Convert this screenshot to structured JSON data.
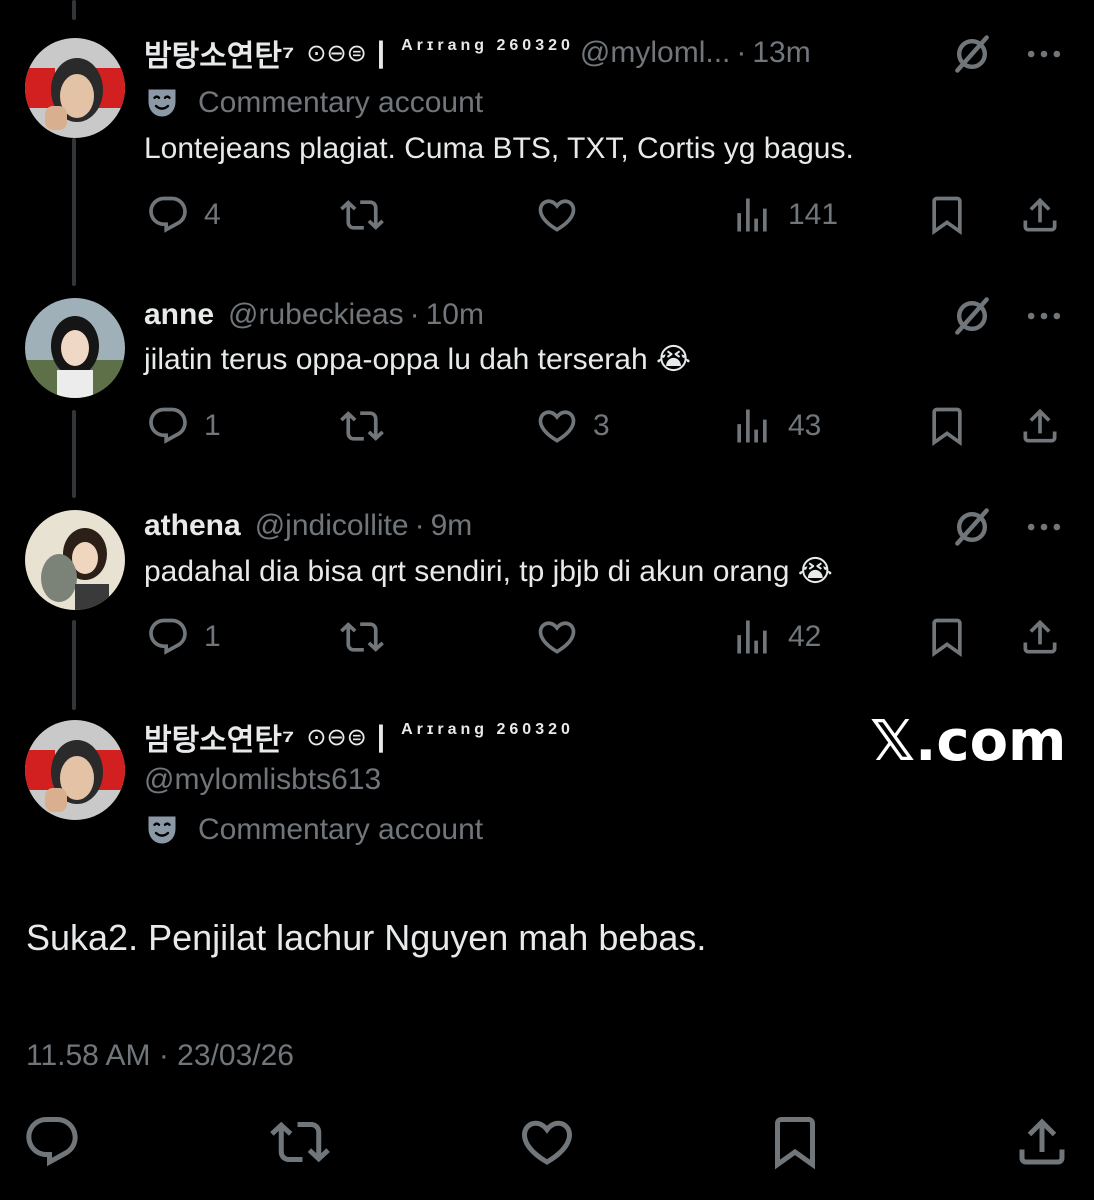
{
  "replies": [
    {
      "display_name": "밤탕소연탄⁷",
      "flair_circles": "⊙⊖⊜",
      "flair_bar": "|",
      "flair_text": "Arɪrang 260320",
      "handle": "@myloml...",
      "separator": "·",
      "time": "13m",
      "label": "Commentary account",
      "text": "Lontejeans plagiat. Cuma BTS, TXT, Cortis yg bagus.",
      "reply_count": "4",
      "retweet_count": "",
      "like_count": "",
      "view_count": "141"
    },
    {
      "display_name": "anne",
      "handle": "@rubeckieas",
      "separator": "·",
      "time": "10m",
      "text": "jilatin terus oppa-oppa lu dah terserah 😭",
      "reply_count": "1",
      "retweet_count": "",
      "like_count": "3",
      "view_count": "43"
    },
    {
      "display_name": "athena",
      "handle": "@jndicollite",
      "separator": "·",
      "time": "9m",
      "text": "padahal dia bisa qrt sendiri, tp jbjb di akun orang 😭",
      "reply_count": "1",
      "retweet_count": "",
      "like_count": "",
      "view_count": "42"
    }
  ],
  "main_post": {
    "display_name": "밤탕소연탄⁷",
    "flair_circles": "⊙⊖⊜",
    "flair_bar": "|",
    "flair_text": "Arɪrang 260320",
    "handle": "@mylomlisbts613",
    "label": "Commentary account",
    "text": "Suka2. Penjilat lachur Nguyen mah bebas.",
    "timestamp": "11.58 AM · 23/03/26"
  },
  "watermark": "𝕏.com",
  "colors": {
    "background": "#000000",
    "primary_text": "#e7e9ea",
    "secondary_text": "#71767b",
    "thread_line": "#333639"
  },
  "icons": [
    "reply-icon",
    "retweet-icon",
    "like-icon",
    "views-icon",
    "bookmark-icon",
    "share-icon",
    "grok-icon",
    "more-icon",
    "theater-mask-icon"
  ]
}
